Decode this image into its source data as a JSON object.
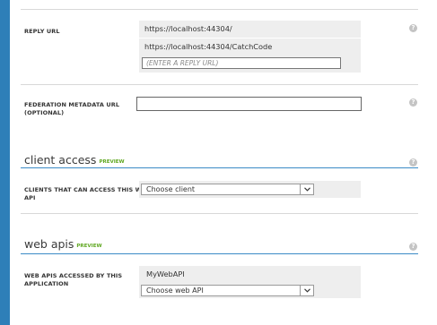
{
  "reply_url": {
    "label": "REPLY URL",
    "urls": [
      "https://localhost:44304/",
      "https://localhost:44304/CatchCode"
    ],
    "new_placeholder": "(ENTER A REPLY URL)"
  },
  "federation": {
    "label_line1": "FEDERATION METADATA URL",
    "label_line2": "(OPTIONAL)",
    "value": ""
  },
  "client_access": {
    "heading": "client access",
    "badge": "PREVIEW",
    "label_line1": "CLIENTS THAT CAN ACCESS THIS WEB",
    "label_line2": "API",
    "select_value": "Choose client"
  },
  "web_apis": {
    "heading": "web apis",
    "badge": "PREVIEW",
    "label_line1": "WEB APIS ACCESSED BY THIS",
    "label_line2": "APPLICATION",
    "api_name": "MyWebAPI",
    "select_value": "Choose web API"
  },
  "help_glyph": "?",
  "colors": {
    "accent": "#2e7fb8",
    "preview_badge": "#5fa720",
    "field_background": "#eeeeee"
  }
}
